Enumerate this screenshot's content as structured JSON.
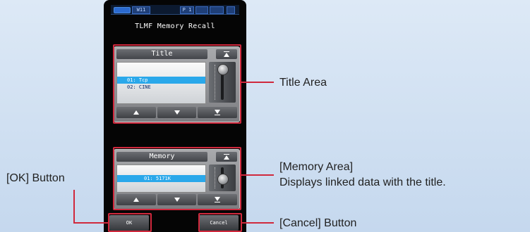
{
  "status_bar": {
    "battery": "",
    "chip1": "W11",
    "chip2": "P 1",
    "chip3": "",
    "chip4": ""
  },
  "screen": {
    "title": "TLMF Memory Recall"
  },
  "title_panel": {
    "header": "Title",
    "rows": [
      "01: Tcp",
      "02: CINE"
    ],
    "selected_index": 0
  },
  "memory_panel": {
    "header": "Memory",
    "rows": [
      "01:  5171K"
    ],
    "selected_index": 0
  },
  "buttons": {
    "ok": "OK",
    "cancel": "Cancel"
  },
  "callouts": {
    "title_area": "Title Area",
    "memory_area_line1": "[Memory Area]",
    "memory_area_line2": "Displays linked data with the title.",
    "ok_button": "[OK] Button",
    "cancel_button": "[Cancel] Button"
  },
  "colors": {
    "highlight": "#d0283c",
    "selection": "#2aa8ea",
    "background": "#cfdff0"
  }
}
